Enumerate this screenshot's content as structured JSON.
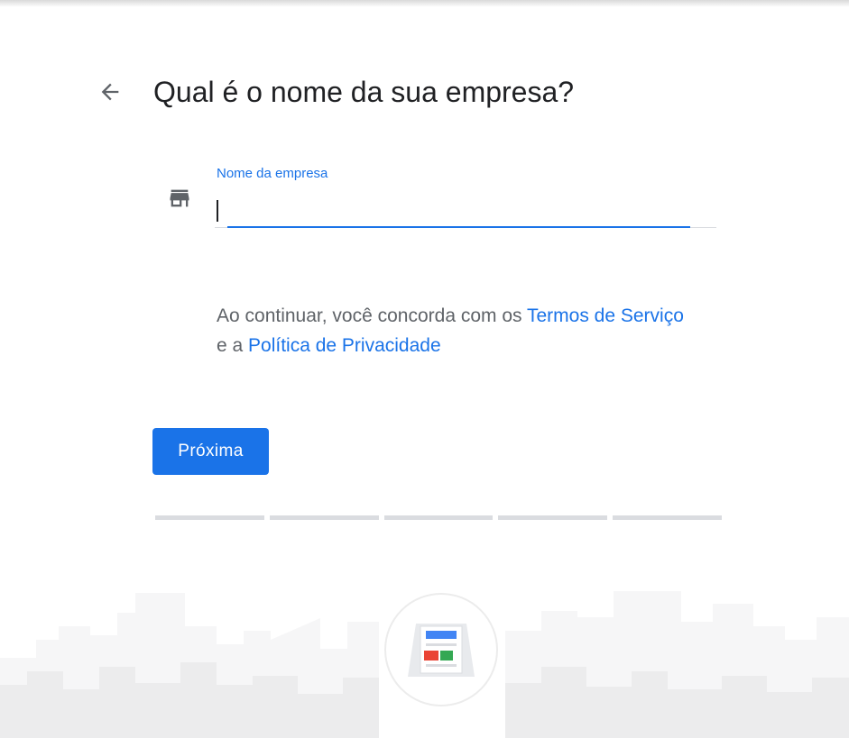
{
  "header": {
    "back_icon": "arrow-back-icon",
    "title": "Qual é o nome da sua empresa?"
  },
  "business_name_field": {
    "icon": "store-icon",
    "label": "Nome da empresa",
    "value": ""
  },
  "terms": {
    "prefix": "Ao continuar, você concorda com os ",
    "terms_link": "Termos de Serviço",
    "middle": " e a ",
    "privacy_link": "Política de Privacidade"
  },
  "next_button": {
    "label": "Próxima"
  },
  "progress": {
    "total_steps": 5,
    "completed_steps": 0
  },
  "colors": {
    "accent": "#1a73e8",
    "title_text": "#202124",
    "body_text": "#5f6368",
    "divider": "#dadce0",
    "illustration_blue": "#4285f4",
    "illustration_red": "#ea4335",
    "illustration_green": "#34a853"
  }
}
